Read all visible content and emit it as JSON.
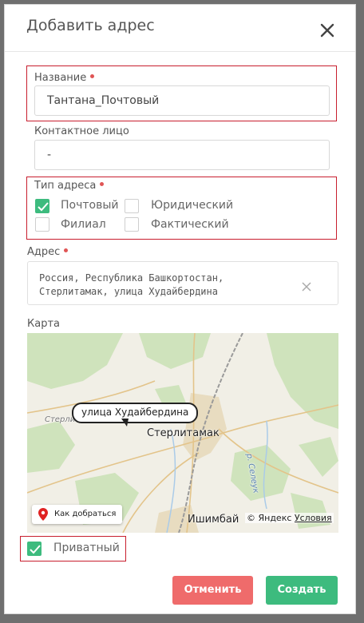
{
  "dialog": {
    "title": "Добавить адрес"
  },
  "form": {
    "name": {
      "label": "Название",
      "value": "Тантана_Почтовый"
    },
    "contact": {
      "label": "Контактное лицо",
      "value": "-"
    },
    "address_type": {
      "label": "Тип адреса",
      "options": [
        {
          "label": "Почтовый",
          "checked": true
        },
        {
          "label": "Юридический",
          "checked": false
        },
        {
          "label": "Филиал",
          "checked": false
        },
        {
          "label": "Фактический",
          "checked": false
        }
      ]
    },
    "address": {
      "label": "Адрес",
      "line1": "Россия, Республика Башкортостан,",
      "line2": "Стерлитамак, улица Худайбердина"
    },
    "map": {
      "label": "Карта",
      "marker_label": "улица Худайбердина",
      "city_main": "Стерлитамак",
      "city_south": "Ишимбай",
      "district": "Стерлитамакский район",
      "river": "р. Селеук",
      "route_button": "Как добраться",
      "attribution_brand": "© Яндекс",
      "attribution_terms": "Условия"
    },
    "private": {
      "label": "Приватный",
      "checked": true
    }
  },
  "buttons": {
    "cancel": "Отменить",
    "create": "Создать"
  },
  "colors": {
    "accent_green": "#3dbb7e",
    "cancel_red": "#ef6b6b",
    "highlight_border": "#c81e2e",
    "required_dot": "#e05555"
  }
}
